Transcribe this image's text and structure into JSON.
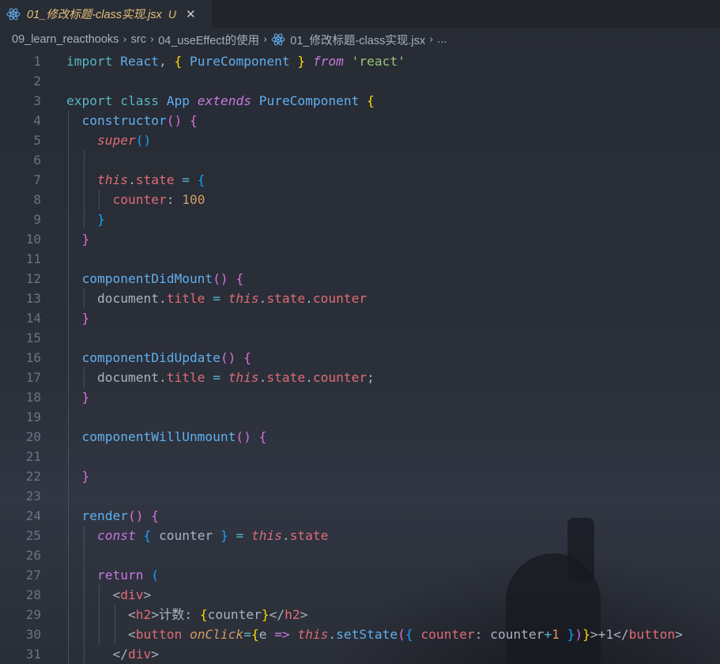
{
  "tab": {
    "title": "01_修改标题-class实现.jsx",
    "status": "U",
    "close": "✕",
    "icon": "react-icon"
  },
  "breadcrumb": {
    "items": [
      "09_learn_reacthooks",
      "src",
      "04_useEffect的使用",
      "01_修改标题-class实现.jsx",
      "..."
    ],
    "separator": "›"
  },
  "editor": {
    "line_numbers": [
      "1",
      "2",
      "3",
      "4",
      "5",
      "6",
      "7",
      "8",
      "9",
      "10",
      "11",
      "12",
      "13",
      "14",
      "15",
      "16",
      "17",
      "18",
      "19",
      "20",
      "21",
      "22",
      "23",
      "24",
      "25",
      "26",
      "27",
      "28",
      "29",
      "30",
      "31"
    ],
    "lines": [
      [
        [
          "kw",
          "import"
        ],
        [
          "txt",
          " "
        ],
        [
          "cls",
          "React"
        ],
        [
          "txt",
          ", "
        ],
        [
          "b1",
          "{"
        ],
        [
          "txt",
          " "
        ],
        [
          "cls",
          "PureComponent"
        ],
        [
          "txt",
          " "
        ],
        [
          "b1",
          "}"
        ],
        [
          "txt",
          " "
        ],
        [
          "kwi",
          "from"
        ],
        [
          "txt",
          " "
        ],
        [
          "str",
          "'react'"
        ]
      ],
      [],
      [
        [
          "kw",
          "export"
        ],
        [
          "txt",
          " "
        ],
        [
          "kw",
          "class"
        ],
        [
          "txt",
          " "
        ],
        [
          "cls",
          "App"
        ],
        [
          "txt",
          " "
        ],
        [
          "kwi",
          "extends"
        ],
        [
          "txt",
          " "
        ],
        [
          "cls",
          "PureComponent"
        ],
        [
          "txt",
          " "
        ],
        [
          "b1",
          "{"
        ]
      ],
      [
        [
          "txt",
          "  "
        ],
        [
          "fn",
          "constructor"
        ],
        [
          "b2",
          "()"
        ],
        [
          "txt",
          " "
        ],
        [
          "b2",
          "{"
        ]
      ],
      [
        [
          "txt",
          "    "
        ],
        [
          "this",
          "super"
        ],
        [
          "b3",
          "()"
        ]
      ],
      [],
      [
        [
          "txt",
          "    "
        ],
        [
          "this",
          "this"
        ],
        [
          "txt",
          "."
        ],
        [
          "prop",
          "state"
        ],
        [
          "txt",
          " "
        ],
        [
          "op",
          "="
        ],
        [
          "txt",
          " "
        ],
        [
          "b3",
          "{"
        ]
      ],
      [
        [
          "txt",
          "      "
        ],
        [
          "prop",
          "counter"
        ],
        [
          "txt",
          ": "
        ],
        [
          "num",
          "100"
        ]
      ],
      [
        [
          "txt",
          "    "
        ],
        [
          "b3",
          "}"
        ]
      ],
      [
        [
          "txt",
          "  "
        ],
        [
          "b2",
          "}"
        ]
      ],
      [],
      [
        [
          "txt",
          "  "
        ],
        [
          "fn",
          "componentDidMount"
        ],
        [
          "b2",
          "()"
        ],
        [
          "txt",
          " "
        ],
        [
          "b2",
          "{"
        ]
      ],
      [
        [
          "txt",
          "    "
        ],
        [
          "var",
          "document"
        ],
        [
          "txt",
          "."
        ],
        [
          "prop",
          "title"
        ],
        [
          "txt",
          " "
        ],
        [
          "op",
          "="
        ],
        [
          "txt",
          " "
        ],
        [
          "this",
          "this"
        ],
        [
          "txt",
          "."
        ],
        [
          "prop",
          "state"
        ],
        [
          "txt",
          "."
        ],
        [
          "prop",
          "counter"
        ]
      ],
      [
        [
          "txt",
          "  "
        ],
        [
          "b2",
          "}"
        ]
      ],
      [],
      [
        [
          "txt",
          "  "
        ],
        [
          "fn",
          "componentDidUpdate"
        ],
        [
          "b2",
          "()"
        ],
        [
          "txt",
          " "
        ],
        [
          "b2",
          "{"
        ]
      ],
      [
        [
          "txt",
          "    "
        ],
        [
          "var",
          "document"
        ],
        [
          "txt",
          "."
        ],
        [
          "prop",
          "title"
        ],
        [
          "txt",
          " "
        ],
        [
          "op",
          "="
        ],
        [
          "txt",
          " "
        ],
        [
          "this",
          "this"
        ],
        [
          "txt",
          "."
        ],
        [
          "prop",
          "state"
        ],
        [
          "txt",
          "."
        ],
        [
          "prop",
          "counter"
        ],
        [
          "txt",
          ";"
        ]
      ],
      [
        [
          "txt",
          "  "
        ],
        [
          "b2",
          "}"
        ]
      ],
      [],
      [
        [
          "txt",
          "  "
        ],
        [
          "fn",
          "componentWillUnmount"
        ],
        [
          "b2",
          "()"
        ],
        [
          "txt",
          " "
        ],
        [
          "b2",
          "{"
        ]
      ],
      [],
      [
        [
          "txt",
          "  "
        ],
        [
          "b2",
          "}"
        ]
      ],
      [],
      [
        [
          "txt",
          "  "
        ],
        [
          "fn",
          "render"
        ],
        [
          "b2",
          "()"
        ],
        [
          "txt",
          " "
        ],
        [
          "b2",
          "{"
        ]
      ],
      [
        [
          "txt",
          "    "
        ],
        [
          "kwi",
          "const"
        ],
        [
          "txt",
          " "
        ],
        [
          "b3",
          "{"
        ],
        [
          "txt",
          " "
        ],
        [
          "var",
          "counter"
        ],
        [
          "txt",
          " "
        ],
        [
          "b3",
          "}"
        ],
        [
          "txt",
          " "
        ],
        [
          "op",
          "="
        ],
        [
          "txt",
          " "
        ],
        [
          "this",
          "this"
        ],
        [
          "txt",
          "."
        ],
        [
          "prop",
          "state"
        ]
      ],
      [],
      [
        [
          "txt",
          "    "
        ],
        [
          "kwp",
          "return"
        ],
        [
          "txt",
          " "
        ],
        [
          "b3",
          "("
        ]
      ],
      [
        [
          "txt",
          "      "
        ],
        [
          "tagp",
          "<"
        ],
        [
          "tag",
          "div"
        ],
        [
          "tagp",
          ">"
        ]
      ],
      [
        [
          "txt",
          "        "
        ],
        [
          "tagp",
          "<"
        ],
        [
          "tag",
          "h2"
        ],
        [
          "tagp",
          ">"
        ],
        [
          "txt",
          "计数: "
        ],
        [
          "b1",
          "{"
        ],
        [
          "var",
          "counter"
        ],
        [
          "b1",
          "}"
        ],
        [
          "tagp",
          "</"
        ],
        [
          "tag",
          "h2"
        ],
        [
          "tagp",
          ">"
        ]
      ],
      [
        [
          "txt",
          "        "
        ],
        [
          "tagp",
          "<"
        ],
        [
          "tag",
          "button"
        ],
        [
          "txt",
          " "
        ],
        [
          "attr",
          "onClick"
        ],
        [
          "op",
          "="
        ],
        [
          "b1",
          "{"
        ],
        [
          "param",
          "e"
        ],
        [
          "txt",
          " "
        ],
        [
          "kwp",
          "=>"
        ],
        [
          "txt",
          " "
        ],
        [
          "this",
          "this"
        ],
        [
          "txt",
          "."
        ],
        [
          "fn",
          "setState"
        ],
        [
          "b2",
          "("
        ],
        [
          "b3",
          "{"
        ],
        [
          "txt",
          " "
        ],
        [
          "prop",
          "counter"
        ],
        [
          "txt",
          ": "
        ],
        [
          "var",
          "counter"
        ],
        [
          "op",
          "+"
        ],
        [
          "num",
          "1"
        ],
        [
          "txt",
          " "
        ],
        [
          "b3",
          "}"
        ],
        [
          "b2",
          ")"
        ],
        [
          "b1",
          "}"
        ],
        [
          "tagp",
          ">"
        ],
        [
          "txt",
          "+1"
        ],
        [
          "tagp",
          "</"
        ],
        [
          "tag",
          "button"
        ],
        [
          "tagp",
          ">"
        ]
      ],
      [
        [
          "txt",
          "      "
        ],
        [
          "tagp",
          "</"
        ],
        [
          "tag",
          "div"
        ],
        [
          "tagp",
          ">"
        ]
      ]
    ]
  }
}
